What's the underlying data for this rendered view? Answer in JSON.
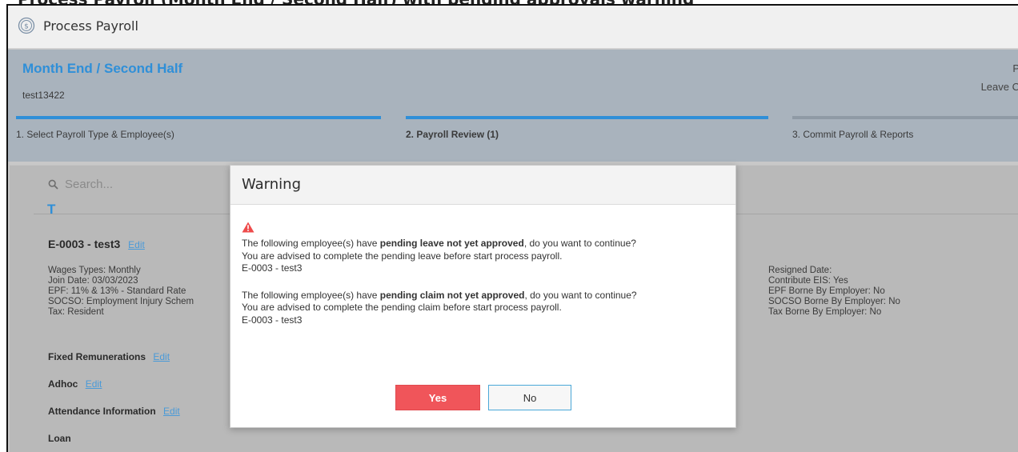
{
  "window": {
    "title": "Process Payroll",
    "logo_icon": "dollar-circle-icon"
  },
  "header": {
    "period": "Month End / Second Half",
    "company": "test13422",
    "right_line1": "P",
    "right_line2": "Leave C",
    "steps": [
      {
        "label": "1. Select Payroll Type & Employee(s)",
        "state": "done"
      },
      {
        "label": "2. Payroll Review (1)",
        "state": "active"
      },
      {
        "label": "3. Commit Payroll & Reports",
        "state": "pending"
      }
    ],
    "accent_color": "#2f8fd8"
  },
  "search": {
    "placeholder": "Search..."
  },
  "employee": {
    "group_letter": "T",
    "title": "E-0003 - test3",
    "edit_label": "Edit",
    "left_info": [
      "Wages Types: Monthly",
      "Join Date: 03/03/2023",
      "EPF: 11% & 13% - Standard Rate",
      "SOCSO: Employment Injury Schem",
      "Tax: Resident"
    ],
    "right_info": [
      "Resigned Date:",
      "Contribute EIS: Yes",
      "EPF Borne By Employer: No",
      "SOCSO Borne By Employer: No",
      "Tax Borne By Employer: No"
    ],
    "sections": [
      {
        "label": "Fixed Remunerations",
        "edit": "Edit"
      },
      {
        "label": "Adhoc",
        "edit": "Edit"
      },
      {
        "label": "Attendance Information",
        "edit": "Edit"
      },
      {
        "label": "Loan",
        "edit": ""
      }
    ]
  },
  "dialog": {
    "title": "Warning",
    "icon": "warning-triangle-icon",
    "leave": {
      "prefix": "The following employee(s) have ",
      "bold": "pending leave not yet approved",
      "suffix": ", do you want to continue?",
      "advice": "You are advised to complete the pending leave before start process payroll.",
      "employee": "E-0003 - test3"
    },
    "claim": {
      "prefix": "The following employee(s) have ",
      "bold": "pending claim not yet approved",
      "suffix": ", do you want to continue?",
      "advice": "You are advised to complete the pending claim before start process payroll.",
      "employee": "E-0003 - test3"
    },
    "yes_label": "Yes",
    "no_label": "No"
  }
}
